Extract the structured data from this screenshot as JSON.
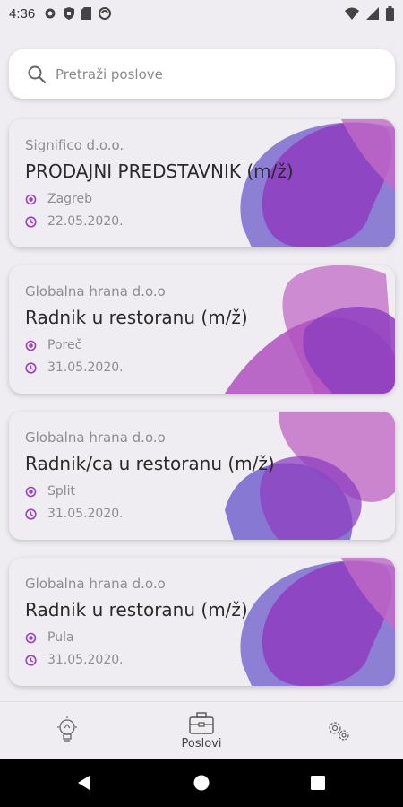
{
  "status_bar": {
    "time": "4:36",
    "left_icons": [
      "settings-icon",
      "shield-icon",
      "sim-icon",
      "sync-icon"
    ],
    "right_icons": [
      "wifi-icon",
      "signal-icon",
      "battery-icon"
    ]
  },
  "search": {
    "placeholder": "Pretraži poslove",
    "value": ""
  },
  "jobs": [
    {
      "company": "Significo d.o.o.",
      "title": "PRODAJNI PREDSTAVNIK (m/ž)",
      "location": "Zagreb",
      "date": "22.05.2020."
    },
    {
      "company": "Globalna hrana d.o.o",
      "title": "Radnik u restoranu (m/ž)",
      "location": "Poreč",
      "date": "31.05.2020."
    },
    {
      "company": "Globalna hrana d.o.o",
      "title": "Radnik/ca u restoranu (m/ž)",
      "location": "Split",
      "date": "31.05.2020."
    },
    {
      "company": "Globalna hrana d.o.o",
      "title": "Radnik u restoranu (m/ž)",
      "location": "Pula",
      "date": "31.05.2020."
    }
  ],
  "bottom_nav": {
    "items": [
      {
        "icon": "lightbulb-icon",
        "label": ""
      },
      {
        "icon": "briefcase-icon",
        "label": "Poslovi"
      },
      {
        "icon": "gears-icon",
        "label": ""
      }
    ]
  },
  "colors": {
    "accent": "#9b3fc4",
    "background": "#efedf1",
    "blob_purple": "#8e3fc0",
    "blob_pink": "#c26ac6",
    "blob_blue": "#7b6ccf"
  }
}
